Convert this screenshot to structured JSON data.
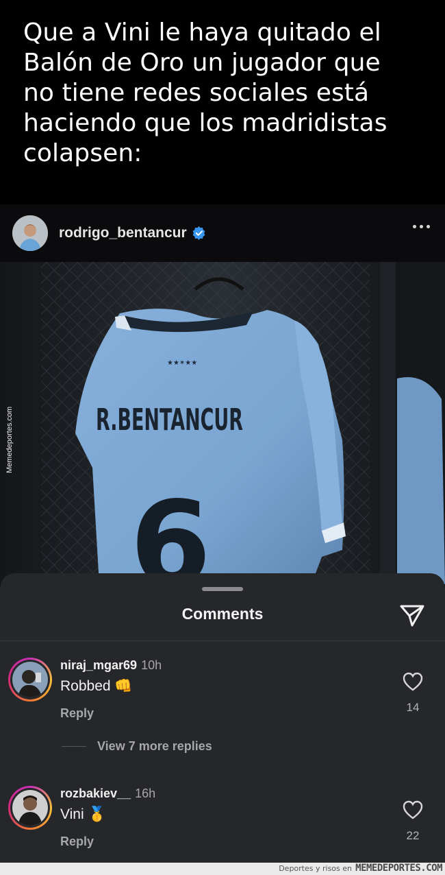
{
  "caption": {
    "lines": [
      "Que a Vini le haya quitado el",
      "Balón de Oro un jugador que",
      "no tiene redes sociales está",
      "haciendo que los madridistas",
      "colapsen:"
    ]
  },
  "post": {
    "username": "rodrigo_bentancur",
    "verified": true,
    "jersey_name": "R.BENTANCUR",
    "jersey_number": "6",
    "side_watermark": "Memedeportes.com"
  },
  "comments_sheet": {
    "title": "Comments",
    "comments": [
      {
        "username": "niraj_mgar69",
        "time": "10h",
        "text": "Robbed 👊",
        "reply_label": "Reply",
        "likes": "14",
        "view_replies": "View 7 more replies"
      },
      {
        "username": "rozbakiev__",
        "time": "16h",
        "text": "Vini 🥇",
        "reply_label": "Reply",
        "likes": "22"
      }
    ]
  },
  "footer": {
    "small": "Deportes y risos en",
    "brand": "MEMEDEPORTES.COM"
  },
  "colors": {
    "background": "#000000",
    "sheet": "#26272b",
    "verified_blue": "#3797f0",
    "jersey_blue": "#7fa9d4"
  }
}
